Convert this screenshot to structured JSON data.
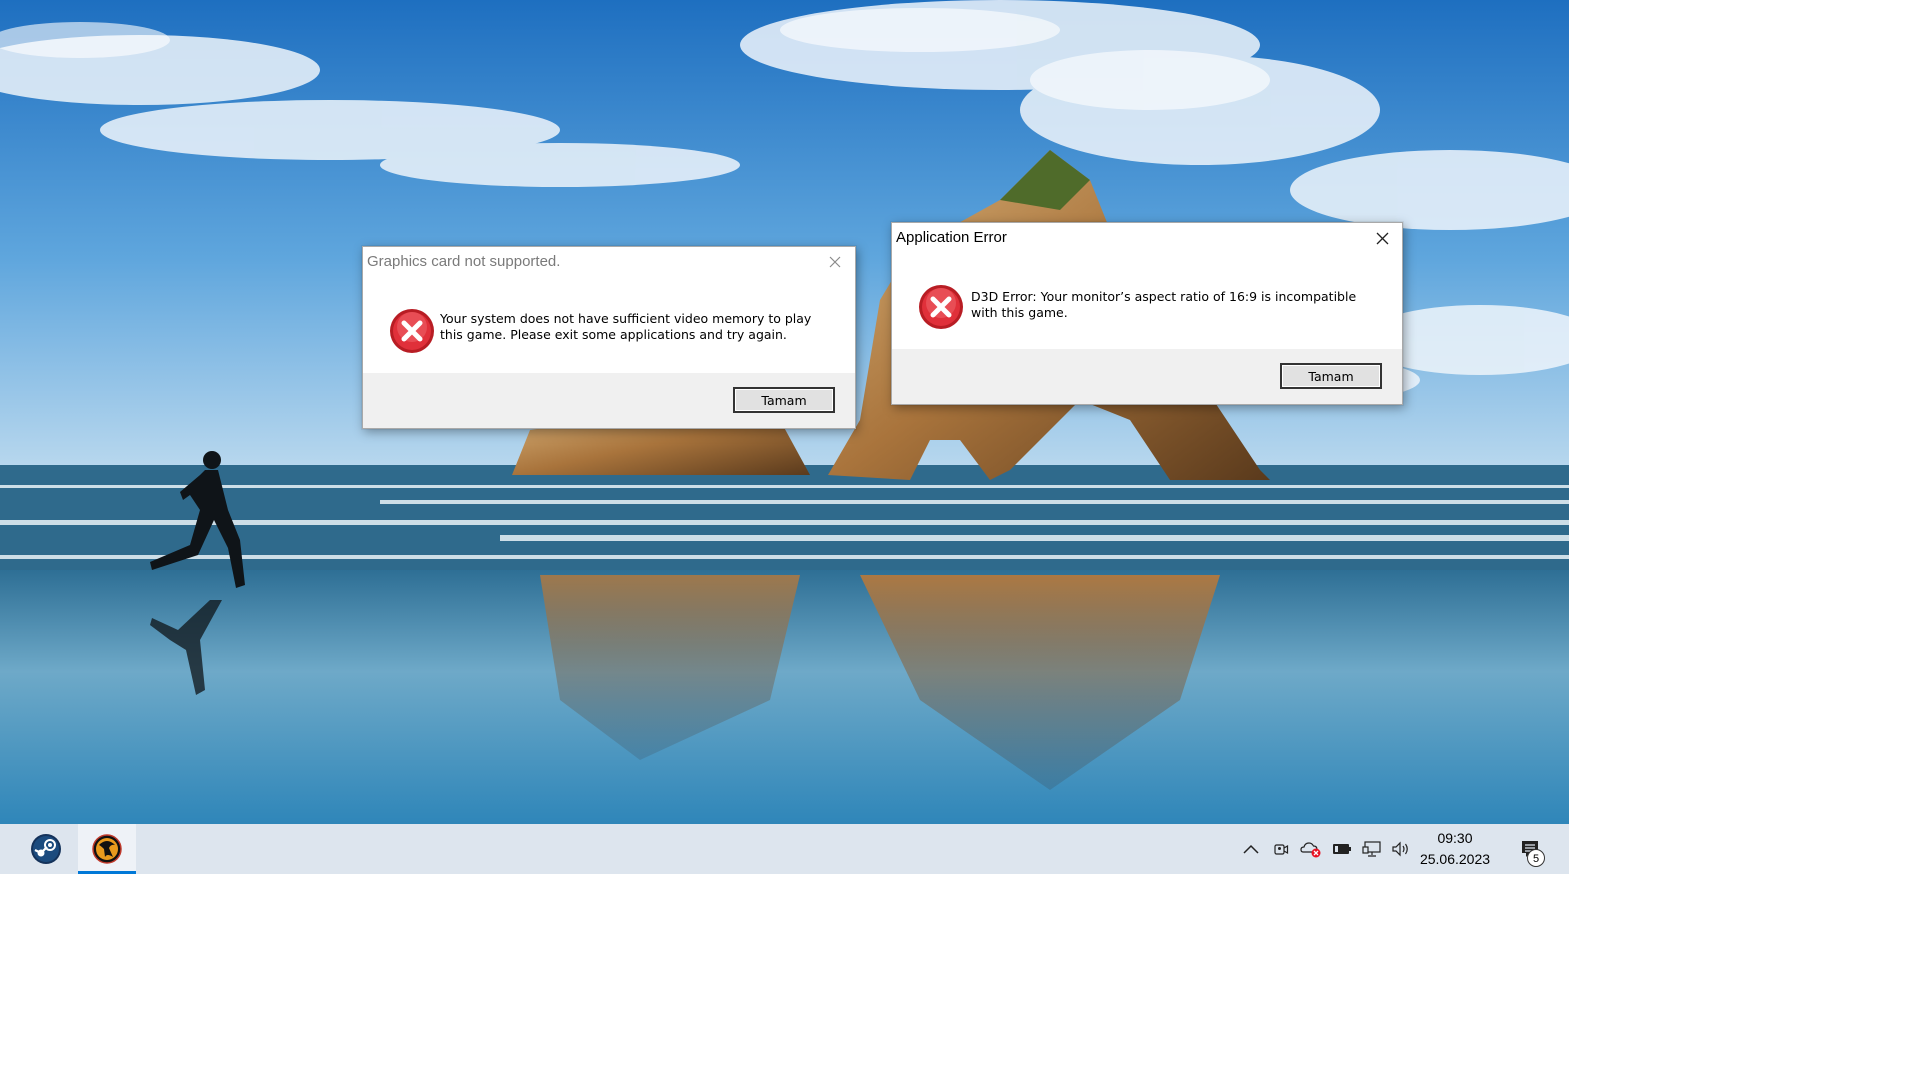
{
  "dialogs": {
    "graphics": {
      "title": "Graphics card not supported.",
      "message_line1": "Your system does not have sufficient video memory to play",
      "message_line2": "this game. Please exit some applications and try again.",
      "button_label": "Tamam",
      "icon": "error-icon"
    },
    "app_error": {
      "title": "Application Error",
      "message_line1": "D3D Error: Your monitor’s aspect ratio of 16:9 is incompatible",
      "message_line2": "with this game.",
      "button_label": "Tamam",
      "icon": "error-icon"
    }
  },
  "taskbar": {
    "apps": [
      {
        "icon": "steam-icon"
      },
      {
        "icon": "mortal-kombat-icon",
        "active": true
      }
    ],
    "tray_icons": [
      "chevron-up-icon",
      "meet-now-icon",
      "onedrive-error-icon",
      "battery-icon",
      "network-icon",
      "volume-icon"
    ],
    "clock": {
      "time": "09:30",
      "date": "25.06.2023"
    },
    "notifications": {
      "icon": "action-center-icon",
      "count": "5"
    }
  },
  "colors": {
    "accent": "#0078d7",
    "error_red": "#d9232f",
    "taskbar_bg": "#dde5ee"
  }
}
